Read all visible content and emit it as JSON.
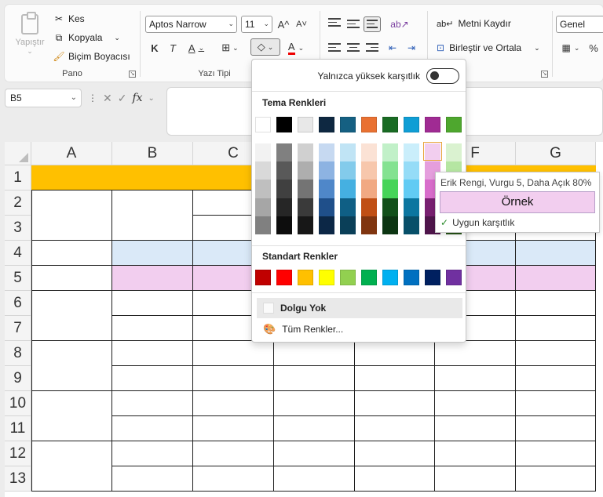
{
  "ribbon": {
    "clipboard": {
      "group_label": "Pano",
      "paste_label": "Yapıştır",
      "cut_label": "Kes",
      "copy_label": "Kopyala",
      "format_painter_label": "Biçim Boyacısı"
    },
    "font": {
      "group_label": "Yazı Tipi",
      "font_name": "Aptos Narrow",
      "font_size": "11",
      "bold": "K",
      "italic": "T",
      "underline": "A",
      "grow": "A^",
      "shrink": "A˅",
      "font_color_glyph": "A"
    },
    "alignment": {
      "wrap_text_label": "Metni Kaydır",
      "merge_center_label": "Birleştir ve Ortala"
    },
    "number": {
      "format_value": "Genel",
      "percent_glyph": "%"
    }
  },
  "formula_bar": {
    "cell_ref": "B5",
    "fx": "fx",
    "cancel": "✕",
    "enter": "✓"
  },
  "columns": [
    "A",
    "B",
    "C",
    "D",
    "E",
    "F",
    "G"
  ],
  "rows": [
    "1",
    "2",
    "3",
    "4",
    "5",
    "6",
    "7",
    "8",
    "9",
    "10",
    "11",
    "12",
    "13"
  ],
  "picker": {
    "high_contrast_label": "Yalnızca yüksek karşıtlık",
    "theme_title": "Tema Renkleri",
    "standard_title": "Standart Renkler",
    "no_fill_label": "Dolgu Yok",
    "more_colors_label": "Tüm Renkler...",
    "theme_colors": [
      "#ffffff",
      "#000000",
      "#e8e8e8",
      "#0e2841",
      "#156082",
      "#e97132",
      "#196b24",
      "#0f9ed5",
      "#a02b93",
      "#4ea72e"
    ],
    "theme_shades": [
      [
        "#f2f2f2",
        "#d9d9d9",
        "#bfbfbf",
        "#a6a6a6",
        "#808080"
      ],
      [
        "#808080",
        "#595959",
        "#404040",
        "#262626",
        "#0d0d0d"
      ],
      [
        "#d0d0d0",
        "#aeaeae",
        "#747474",
        "#3a3a3a",
        "#171717"
      ],
      [
        "#c6d9f1",
        "#8db3e2",
        "#4f87c9",
        "#1f4f8a",
        "#0c2746"
      ],
      [
        "#c0e4f5",
        "#83cbeb",
        "#45b0e1",
        "#0f5f85",
        "#0a3f58"
      ],
      [
        "#fbe2d5",
        "#f7c7ac",
        "#f1a983",
        "#c04f15",
        "#803510"
      ],
      [
        "#c1f0c8",
        "#84e291",
        "#47d459",
        "#12501a",
        "#0c3512"
      ],
      [
        "#caeefb",
        "#95dcf7",
        "#61cbf4",
        "#0b76a0",
        "#074f69"
      ],
      [
        "#f2ceef",
        "#e59edd",
        "#d86dcb",
        "#782070",
        "#4f154b"
      ],
      [
        "#daf2d0",
        "#b5e6a2",
        "#8ed973",
        "#3a7d22",
        "#275317"
      ]
    ],
    "standard_colors": [
      "#c00000",
      "#ff0000",
      "#ffc000",
      "#ffff00",
      "#92d050",
      "#00b050",
      "#00b0f0",
      "#0070c0",
      "#002060",
      "#7030a0"
    ]
  },
  "tooltip": {
    "title": "Erik Rengi, Vurgu 5, Daha Açık 80%",
    "sample": "Örnek",
    "contrast_ok": "Uygun karşıtlık"
  },
  "fills": {
    "row1": "#ffc000",
    "row4": "#dae9f8",
    "row5": "#f2ceef"
  }
}
